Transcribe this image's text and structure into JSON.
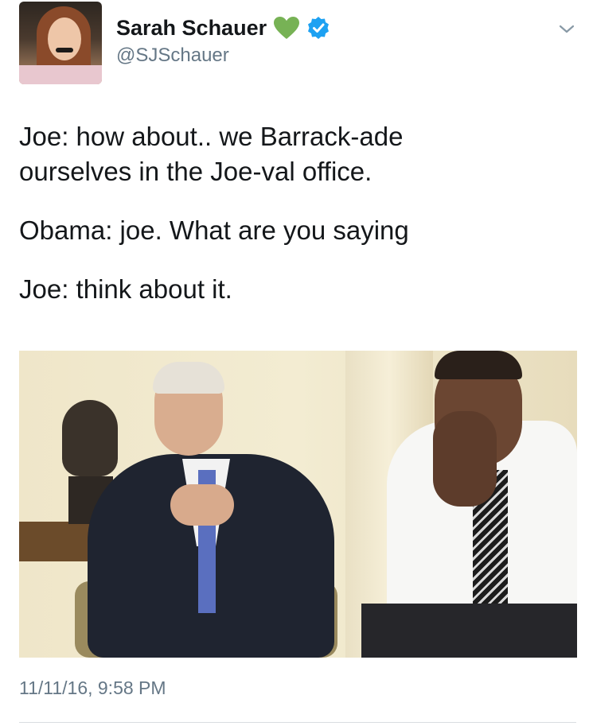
{
  "author": {
    "name": "Sarah Schauer",
    "handle": "@SJSchauer",
    "emoji": "green-heart",
    "verified": true
  },
  "tweet": {
    "lines": [
      "Joe: how about.. we Barrack-ade",
      "ourselves in the Joe-val office.",
      "Obama: joe. What are you saying",
      "Joe: think about it."
    ],
    "timestamp": "11/11/16, 9:58 PM"
  },
  "colors": {
    "text": "#14171a",
    "secondary": "#657786",
    "verified_blue": "#1da1f2",
    "heart_green": "#77b255"
  },
  "icons": {
    "heart": "green-heart-icon",
    "verified": "verified-badge-icon",
    "menu": "chevron-down-icon"
  }
}
